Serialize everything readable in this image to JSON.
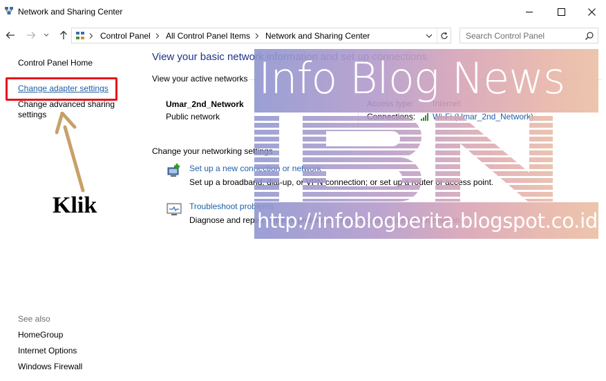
{
  "window": {
    "title": "Network and Sharing Center",
    "icon": "network-sharing-icon"
  },
  "address": {
    "crumbs": [
      "Control Panel",
      "All Control Panel Items",
      "Network and Sharing Center"
    ]
  },
  "search": {
    "placeholder": "Search Control Panel"
  },
  "left_pane": {
    "home": "Control Panel Home",
    "adapter": "Change adapter settings",
    "advanced": "Change advanced sharing settings",
    "annotation": "Klik",
    "see_also_label": "See also",
    "see_also": [
      "HomeGroup",
      "Internet Options",
      "Windows Firewall"
    ]
  },
  "main": {
    "title": "View your basic network information and set up connections",
    "active_networks_label": "View your active networks",
    "network": {
      "name": "Umar_2nd_Network",
      "type": "Public network",
      "access_type_label": "Access type:",
      "access_type_value": "Internet",
      "connections_label": "Connections:",
      "connections_value": "Wi-Fi (Umar_2nd_Network)"
    },
    "change_label": "Change your networking settings",
    "tasks": [
      {
        "link": "Set up a new connection or network",
        "desc": "Set up a broadband, dial-up, or VPN connection; or set up a router or access point."
      },
      {
        "link": "Troubleshoot problems",
        "desc": "Diagnose and repair network problems, or get troubleshooting information."
      }
    ]
  },
  "watermark": {
    "line1": "Info Blog News",
    "logo": "IBN",
    "url": "http://infoblogberita.blogspot.co.id"
  },
  "colors": {
    "link": "#1f5fa8",
    "title": "#1e3287",
    "highlight": "#e8101b",
    "arrow": "#c8a068"
  }
}
